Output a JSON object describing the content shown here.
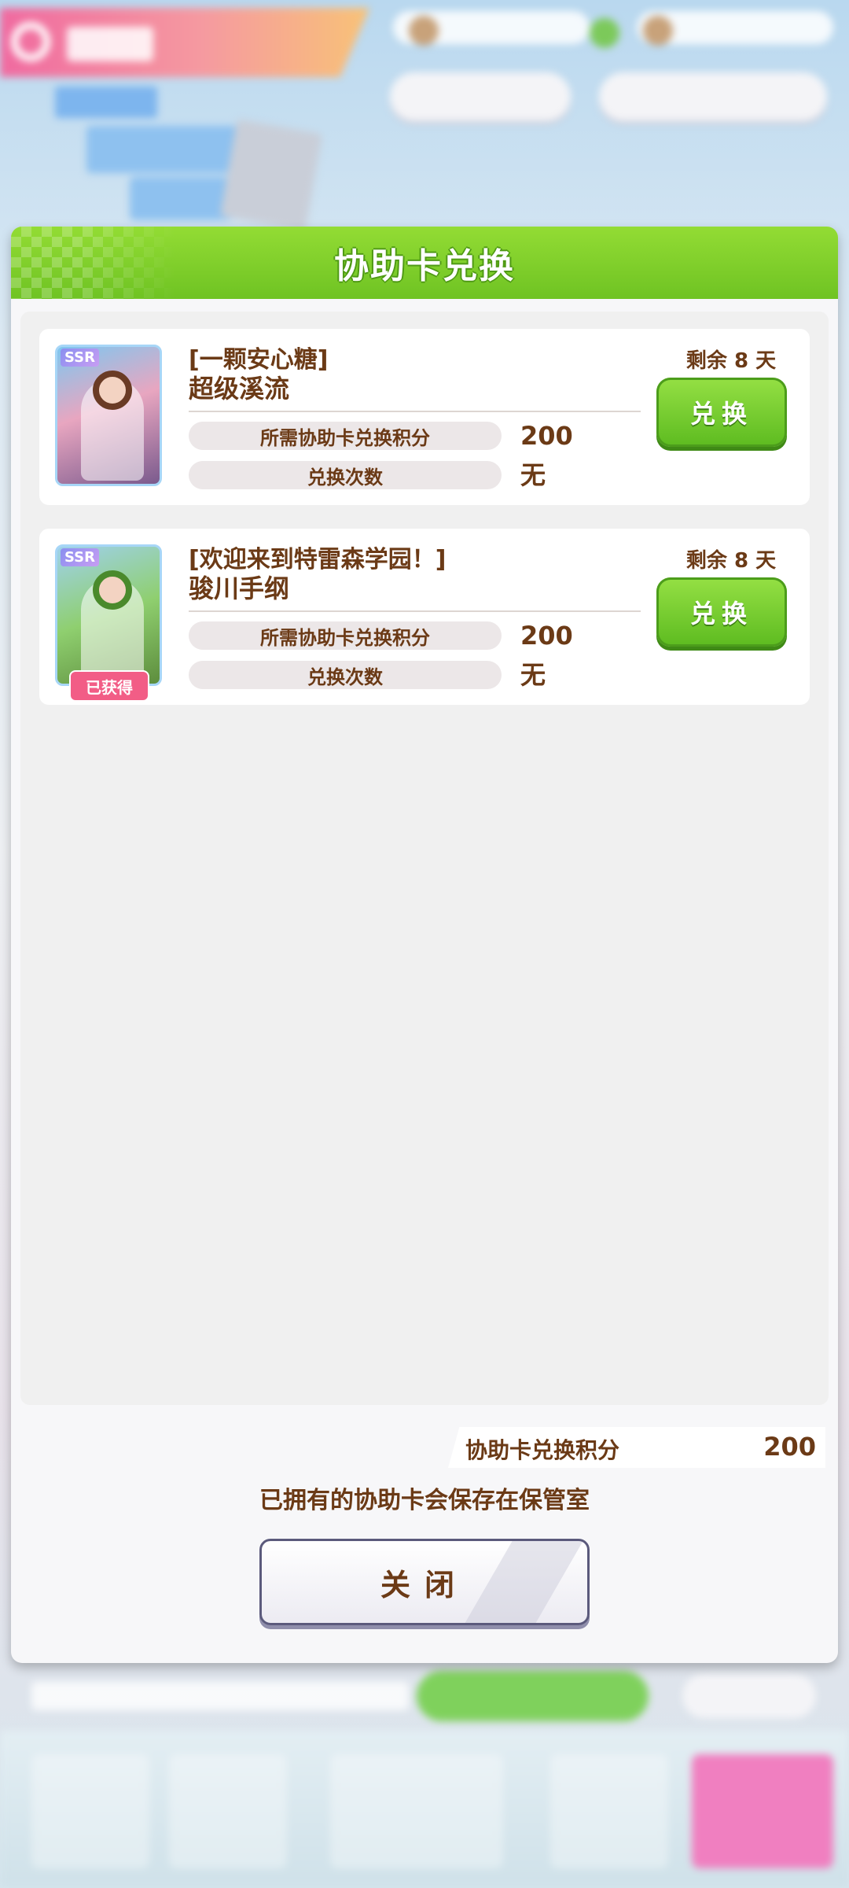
{
  "dialog": {
    "title": "协助卡兑换",
    "cards": [
      {
        "rarity": "SSR",
        "title": "[一颗安心糖]",
        "name": "超级溪流",
        "remaining": "剩余 8 天",
        "cost_label": "所需协助卡兑换积分",
        "cost_value": "200",
        "count_label": "兑换次数",
        "count_value": "无",
        "button_label": "兑换",
        "owned": false
      },
      {
        "rarity": "SSR",
        "title": "[欢迎来到特雷森学园！]",
        "name": "骏川手纲",
        "remaining": "剩余 8 天",
        "cost_label": "所需协助卡兑换积分",
        "cost_value": "200",
        "count_label": "兑换次数",
        "count_value": "无",
        "button_label": "兑换",
        "owned": true,
        "owned_label": "已获得"
      }
    ],
    "points_label": "协助卡兑换积分",
    "points_value": "200",
    "note": "已拥有的协助卡会保存在保管室",
    "close_label": "关闭"
  },
  "colors": {
    "header_green": "#7fd029",
    "text_brown": "#6b3a16",
    "button_green": "#5dbb20",
    "owned_pink": "#f25d86"
  }
}
